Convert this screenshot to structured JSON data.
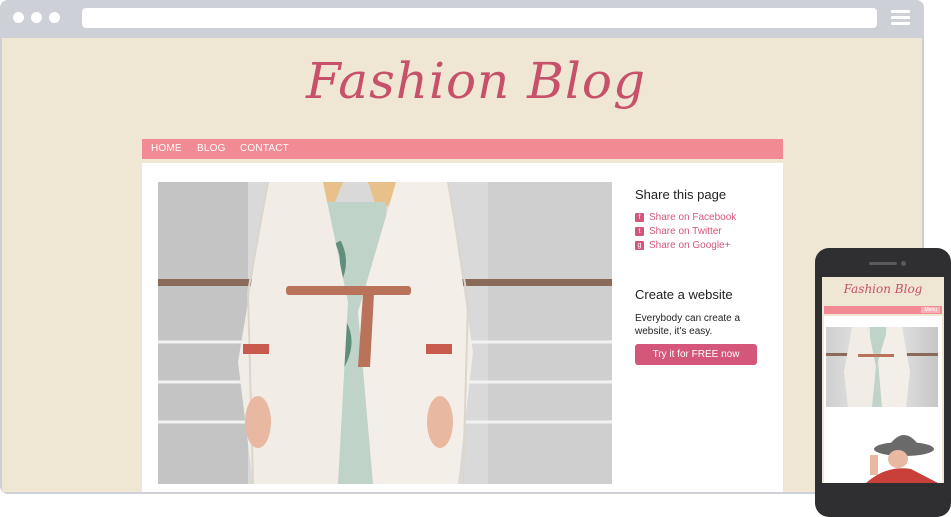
{
  "blog": {
    "title": "Fashion Blog",
    "nav": [
      "HOME",
      "BLOG",
      "CONTACT"
    ]
  },
  "sidebar": {
    "share_heading": "Share this page",
    "share_links": [
      {
        "label": "Share on Facebook",
        "icon": "facebook-icon"
      },
      {
        "label": "Share on Twitter",
        "icon": "twitter-icon"
      },
      {
        "label": "Share on Google+",
        "icon": "google-plus-icon"
      }
    ],
    "create_heading": "Create a website",
    "create_text": "Everybody can create a website, it's easy.",
    "cta_label": "Try it for FREE now"
  },
  "mobile": {
    "title": "Fashion Blog",
    "menu_label": "Menu"
  },
  "colors": {
    "page_background": "#efe6d3",
    "nav_background": "#f28a93",
    "accent": "#d4577a",
    "title": "#c7506a"
  }
}
